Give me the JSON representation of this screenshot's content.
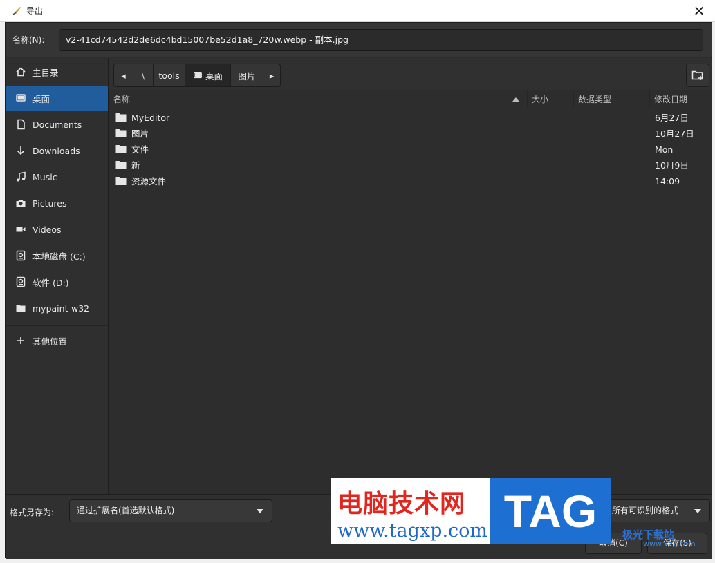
{
  "window": {
    "title": "导出",
    "close_glyph": "✕"
  },
  "name_field": {
    "label": "名称(N):",
    "value": "v2-41cd74542d2de6dc4bd15007be52d1a8_720w.webp - 副本.jpg"
  },
  "sidebar": {
    "items": [
      {
        "label": "主目录",
        "icon": "home-icon"
      },
      {
        "label": "桌面",
        "icon": "desktop-icon",
        "active": true
      },
      {
        "label": "Documents",
        "icon": "document-icon"
      },
      {
        "label": "Downloads",
        "icon": "download-icon"
      },
      {
        "label": "Music",
        "icon": "music-icon"
      },
      {
        "label": "Pictures",
        "icon": "camera-icon"
      },
      {
        "label": "Videos",
        "icon": "video-icon"
      },
      {
        "label": "本地磁盘 (C:)",
        "icon": "drive-icon"
      },
      {
        "label": "软件 (D:)",
        "icon": "drive-icon"
      },
      {
        "label": "mypaint-w32",
        "icon": "folder-icon"
      },
      {
        "label": "其他位置",
        "icon": "plus-icon"
      }
    ]
  },
  "pathbar": {
    "back_glyph": "◂",
    "segments": [
      "\\",
      "tools",
      "桌面",
      "图片"
    ],
    "forward_glyph": "▸"
  },
  "columns": {
    "name": "名称",
    "size": "大小",
    "type": "数据类型",
    "modified": "修改日期"
  },
  "files": [
    {
      "name": "MyEditor",
      "modified": "6月27日",
      "icon": "folder-icon"
    },
    {
      "name": "图片",
      "modified": "10月27日",
      "icon": "folder-icon"
    },
    {
      "name": "文件",
      "modified": "Mon",
      "icon": "folder-icon"
    },
    {
      "name": "新",
      "modified": "10月9日",
      "icon": "folder-icon"
    },
    {
      "name": "资源文件",
      "modified": "14:09",
      "icon": "folder-icon"
    }
  ],
  "bottom": {
    "format_label": "格式另存为:",
    "format_value": "通过扩展名(首选默认格式)",
    "filter_value": "所有可识别的格式",
    "cancel_label": "取消(C)",
    "save_label": "保存(S)"
  },
  "watermark": {
    "site_name": "电脑技术网",
    "url": "www.tagxp.com",
    "tag": "TAG",
    "corner_text": "极光下载站",
    "corner_url": "www.xz7.com"
  },
  "colors": {
    "accent": "#215d9c",
    "background": "#2d2d2d",
    "watermark_red": "#e0261f",
    "watermark_blue": "#1d6fd1"
  }
}
